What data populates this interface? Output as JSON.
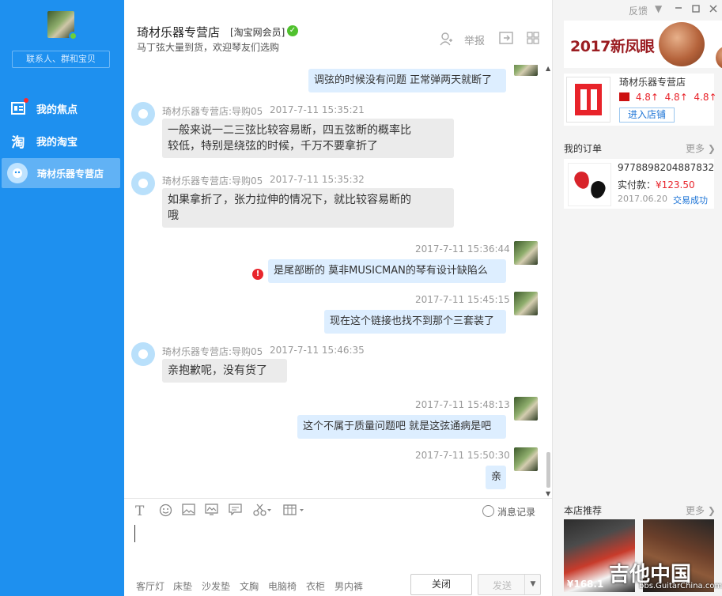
{
  "sidebar": {
    "search_placeholder": "联系人、群和宝贝",
    "items": [
      {
        "label": "我的焦点"
      },
      {
        "label": "我的淘宝"
      },
      {
        "label": "琦材乐器专营店"
      }
    ]
  },
  "header": {
    "shop_name": "琦材乐器专营店",
    "member_tag": "[淘宝网会员]",
    "notice": "马丁弦大量到货，欢迎琴友们选购",
    "report_label": "举报"
  },
  "messages": [
    {
      "direction": "out",
      "text": "调弦的时候没有问题  正常弹两天就断了"
    },
    {
      "direction": "in",
      "sender": "琦材乐器专营店:导购05",
      "time": "2017-7-11 15:35:21",
      "lines": [
        "一般来说一二三弦比较容易断，四五弦断的概率比",
        "较低，特别是绕弦的时候，千万不要拿折了"
      ]
    },
    {
      "direction": "in",
      "sender": "琦材乐器专营店:导购05",
      "time": "2017-7-11 15:35:32",
      "lines": [
        "如果拿折了，张力拉伸的情况下，就比较容易断的",
        "哦"
      ]
    },
    {
      "direction": "out",
      "time": "2017-7-11 15:36:44",
      "text": "是尾部断的  莫非MUSICMAN的琴有设计缺陷么",
      "failed": true
    },
    {
      "direction": "out",
      "time": "2017-7-11 15:45:15",
      "text": "现在这个链接也找不到那个三套装了"
    },
    {
      "direction": "in",
      "sender": "琦材乐器专营店:导购05",
      "time": "2017-7-11 15:46:35",
      "lines": [
        "亲抱歉呢，没有货了"
      ]
    },
    {
      "direction": "out",
      "time": "2017-7-11 15:48:13",
      "text": "这个不属于质量问题吧  就是这弦通病是吧"
    },
    {
      "direction": "out",
      "time": "2017-7-11 15:50:30",
      "text": "亲"
    }
  ],
  "toolbar": {
    "history_label": "消息记录"
  },
  "bottom_bar": {
    "ad_words": [
      "客厅灯",
      "床垫",
      "沙发垫",
      "文胸",
      "电脑椅",
      "衣柜",
      "男内裤"
    ],
    "close_label": "关闭",
    "send_label": "发送"
  },
  "window": {
    "feedback_label": "反馈"
  },
  "right_panel": {
    "banner_text": "2017新凤眼",
    "store": {
      "name": "琦材乐器专营店",
      "ratings": [
        "4.8↑",
        "4.8↑",
        "4.8↑"
      ],
      "enter_label": "进入店铺"
    },
    "orders": {
      "title": "我的订单",
      "more_label": "更多 ❯",
      "order_id": "9778898204887832",
      "paid_label": "实付款：",
      "paid_value": "¥123.50",
      "date": "2017.06.20",
      "status": "交易成功"
    },
    "recommend": {
      "title": "本店推荐",
      "more_label": "更多 ❯",
      "price": "¥168.1"
    },
    "watermark": "吉他中国",
    "watermark_sub": "bbs.GuitarChina.com"
  },
  "colors": {
    "sidebar_blue": "#1e90ef",
    "incoming_bubble": "#ebebeb",
    "outgoing_bubble": "#ddeeff",
    "price_red": "#e8232a"
  }
}
